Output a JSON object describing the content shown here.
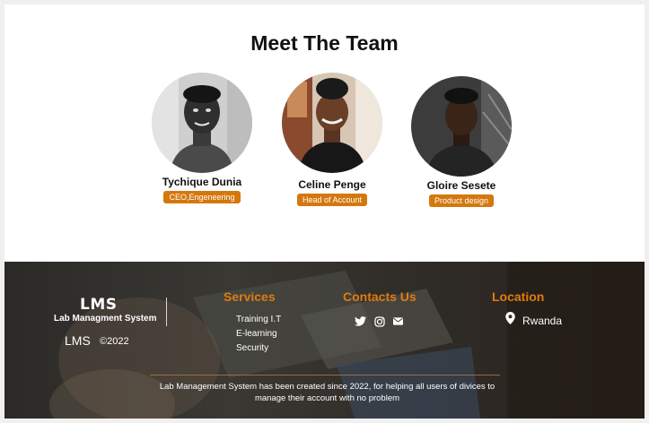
{
  "team": {
    "title": "Meet The Team",
    "members": [
      {
        "name": "Tychique Dunia",
        "role": "CEO,Engeneering"
      },
      {
        "name": "Celine Penge",
        "role": "Head of Account"
      },
      {
        "name": "Gloire Sesete",
        "role": "Product design"
      }
    ]
  },
  "footer": {
    "brand": {
      "mark": "LMS",
      "name": "Lab Managment System",
      "short": "LMS",
      "copyright": "©2022"
    },
    "services": {
      "title": "Services",
      "items": [
        "Training I.T",
        "E-learning",
        "Security"
      ]
    },
    "contacts": {
      "title": "Contacts Us",
      "icons": [
        "twitter-icon",
        "instagram-icon",
        "mail-icon"
      ]
    },
    "location": {
      "title": "Location",
      "value": "Rwanda",
      "icon": "location-pin-icon"
    },
    "note": "Lab Management System has been created since 2022, for helping all users of divices to manage their account with no problem"
  },
  "colors": {
    "accent": "#d4780e",
    "footer_title": "#e07b10"
  }
}
